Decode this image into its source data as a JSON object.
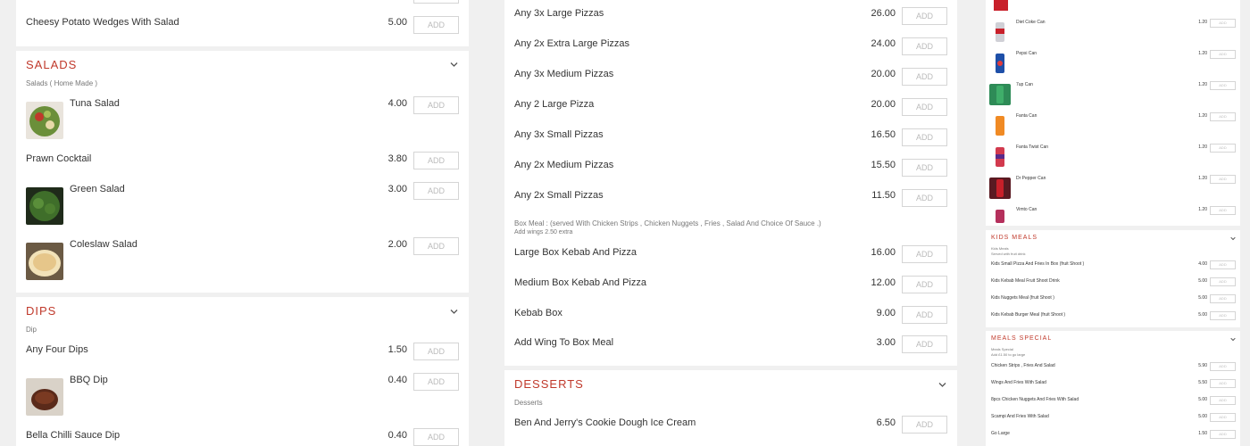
{
  "colors": {
    "accent": "#c0392b",
    "page_bg": "#f0f0f0",
    "text": "#333333",
    "muted": "#777777",
    "button_border": "#d5d5d5"
  },
  "left": {
    "top_item": {
      "name": "Cheesy Potato Wedges With Salad",
      "price": "5.00",
      "add": "ADD"
    },
    "salads": {
      "title": "SALADS",
      "subtitle": "Salads ( Home Made )",
      "items": [
        {
          "name": "Tuna Salad",
          "price": "4.00",
          "add": "ADD"
        },
        {
          "name": "Prawn Cocktail",
          "price": "3.80",
          "add": "ADD"
        },
        {
          "name": "Green Salad",
          "price": "3.00",
          "add": "ADD"
        },
        {
          "name": "Coleslaw Salad",
          "price": "2.00",
          "add": "ADD"
        }
      ]
    },
    "dips": {
      "title": "DIPS",
      "subtitle": "Dip",
      "items": [
        {
          "name": "Any Four Dips",
          "price": "1.50",
          "add": "ADD"
        },
        {
          "name": "BBQ Dip",
          "price": "0.40",
          "add": "ADD"
        },
        {
          "name": "Bella Chilli Sauce Dip",
          "price": "0.40",
          "add": "ADD"
        }
      ]
    }
  },
  "middle": {
    "deals": [
      {
        "name": "Any 3x Large Pizzas",
        "price": "26.00",
        "add": "ADD"
      },
      {
        "name": "Any 2x Extra Large Pizzas",
        "price": "24.00",
        "add": "ADD"
      },
      {
        "name": "Any 3x Medium Pizzas",
        "price": "20.00",
        "add": "ADD"
      },
      {
        "name": "Any 2 Large Pizza",
        "price": "20.00",
        "add": "ADD"
      },
      {
        "name": "Any 3x Small Pizzas",
        "price": "16.50",
        "add": "ADD"
      },
      {
        "name": "Any 2x Medium Pizzas",
        "price": "15.50",
        "add": "ADD"
      },
      {
        "name": "Any 2x Small Pizzas",
        "price": "11.50",
        "add": "ADD"
      }
    ],
    "box_meal": {
      "desc": "Box Meal : (served With Chicken Strips , Chicken Nuggets , Fries , Salad And Choice Of Sauce .)",
      "extra": "Add wings 2.50 extra",
      "items": [
        {
          "name": "Large Box Kebab And Pizza",
          "price": "16.00",
          "add": "ADD"
        },
        {
          "name": "Medium Box Kebab And Pizza",
          "price": "12.00",
          "add": "ADD"
        },
        {
          "name": "Kebab Box",
          "price": "9.00",
          "add": "ADD"
        },
        {
          "name": "Add Wing To Box Meal",
          "price": "3.00",
          "add": "ADD"
        }
      ]
    },
    "desserts": {
      "title": "DESSERTS",
      "subtitle": "Desserts",
      "items": [
        {
          "name": "Ben And Jerry's Cookie Dough Ice Cream",
          "price": "6.50",
          "add": "ADD"
        }
      ]
    }
  },
  "right": {
    "drinks": [
      {
        "name": "Diet Coke Can",
        "price": "1.20",
        "add": "ADD",
        "color": "#d0d0d6"
      },
      {
        "name": "Pepsi Can",
        "price": "1.20",
        "add": "ADD",
        "color": "#1e4fa8"
      },
      {
        "name": "7up Can",
        "price": "1.20",
        "add": "ADD",
        "color": "#2e8b57"
      },
      {
        "name": "Fanta Can",
        "price": "1.20",
        "add": "ADD",
        "color": "#f08a24"
      },
      {
        "name": "Fanta Twist Can",
        "price": "1.20",
        "add": "ADD",
        "color": "#d23a4e"
      },
      {
        "name": "Dr Pepper Can",
        "price": "1.20",
        "add": "ADD",
        "color": "#8b1a2b"
      },
      {
        "name": "Vimto Can",
        "price": "1.20",
        "add": "ADD",
        "color": "#b5305c"
      }
    ],
    "kids_meals": {
      "title": "KIDS MEALS",
      "subtitle": "Kids Meals",
      "note": "Served with fruit drink",
      "items": [
        {
          "name": "Kids Small Pizza And Fries In Box (fruit Shoot )",
          "price": "4.00",
          "add": "ADD"
        },
        {
          "name": "Kids Kebab Meal Fruit Shoot Drink",
          "price": "5.00",
          "add": "ADD"
        },
        {
          "name": "Kids Nuggets Meal (fruit Shoot )",
          "price": "5.00",
          "add": "ADD"
        },
        {
          "name": "Kids Kebab Burger Meal (fruit Shoot )",
          "price": "5.00",
          "add": "ADD"
        }
      ]
    },
    "meals_special": {
      "title": "MEALS SPECIAL",
      "subtitle": "Meals Special",
      "note": "Add £1.50 to go large",
      "items": [
        {
          "name": "Chicken Strips , Fries And Salad",
          "price": "5.90",
          "add": "ADD"
        },
        {
          "name": "Wings And Fries With Salad",
          "price": "5.50",
          "add": "ADD"
        },
        {
          "name": "8pcs Chicken Nuggets And Fries With Salad",
          "price": "5.00",
          "add": "ADD"
        },
        {
          "name": "Scampi And Fries With Salad",
          "price": "5.00",
          "add": "ADD"
        },
        {
          "name": "Go Large",
          "price": "1.50",
          "add": "ADD"
        }
      ]
    }
  }
}
